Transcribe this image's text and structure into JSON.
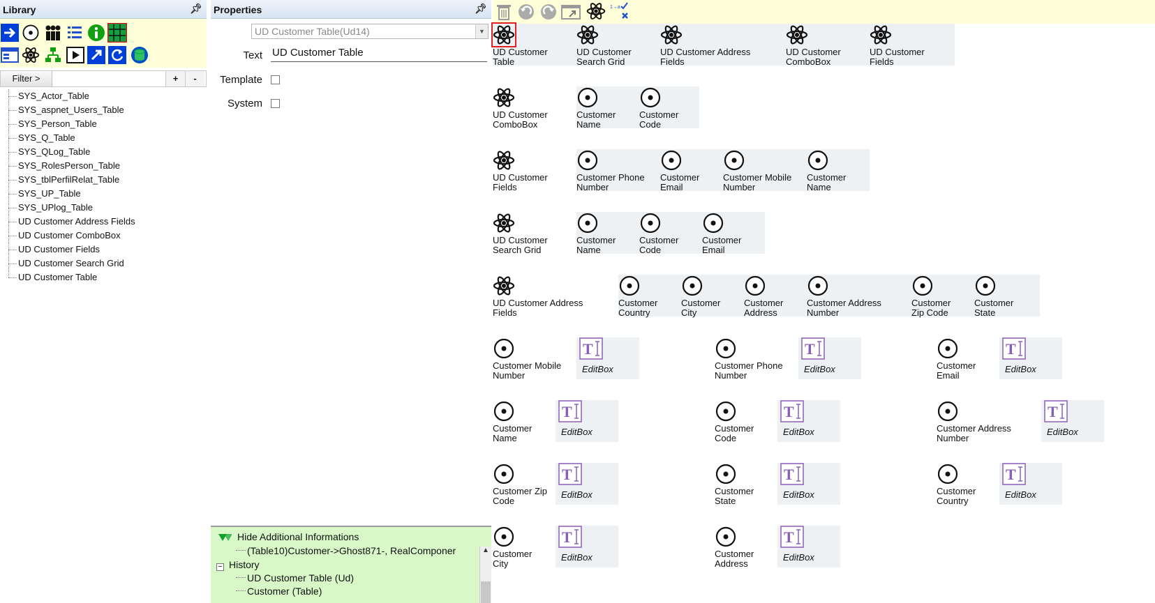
{
  "library": {
    "title": "Library",
    "filter_label": "Filter >",
    "filter_value": "",
    "add_label": "+",
    "remove_label": "-",
    "items": [
      "SYS_Actor_Table",
      "SYS_aspnet_Users_Table",
      "SYS_Person_Table",
      "SYS_Q_Table",
      "SYS_QLog_Table",
      "SYS_RolesPerson_Table",
      "SYS_tblPerfilRelat_Table",
      "SYS_UP_Table",
      "SYS_UPlog_Table",
      "UD Customer Address Fields",
      "UD Customer ComboBox",
      "UD Customer Fields",
      "UD Customer Search Grid",
      "UD Customer Table"
    ]
  },
  "properties": {
    "title": "Properties",
    "combo_value": "UD Customer Table(Ud14)",
    "text_label": "Text",
    "text_value": "UD Customer Table",
    "template_label": "Template",
    "system_label": "System",
    "hide_info_label": "Hide Additional Informations",
    "info_line": "(Table10)Customer->Ghost871-, RealComponer",
    "history_label": "History",
    "history_items": [
      "UD Customer Table (Ud)",
      "Customer (Table)"
    ]
  },
  "canvas": {
    "row1": [
      "UD Customer Table",
      "UD Customer Search Grid",
      "UD Customer Address Fields",
      "UD Customer ComboBox",
      "UD Customer Fields"
    ],
    "row2": [
      "UD Customer ComboBox",
      "Customer Name",
      "Customer Code"
    ],
    "row3": [
      "UD Customer Fields",
      "Customer Phone Number",
      "Customer Email",
      "Customer Mobile Number",
      "Customer Name"
    ],
    "row4": [
      "UD Customer Search Grid",
      "Customer Name",
      "Customer Code",
      "Customer Email"
    ],
    "row5": [
      "UD Customer Address Fields",
      "Customer Country",
      "Customer City",
      "Customer Address",
      "Customer Address Number",
      "Customer Zip Code",
      "Customer State"
    ],
    "fields": [
      [
        "Customer Mobile Number",
        "Customer Phone Number",
        "Customer Email"
      ],
      [
        "Customer Name",
        "Customer Code",
        "Customer Address Number"
      ],
      [
        "Customer Zip Code",
        "Customer State",
        "Customer Country"
      ],
      [
        "Customer City",
        "Customer Address"
      ]
    ],
    "editbox_label": "EditBox"
  },
  "colors": {
    "accent": "#0040d8",
    "tool_bg": "#fefed8",
    "info_bg": "#d8f8c8",
    "editbox": "#8a5fb8"
  }
}
